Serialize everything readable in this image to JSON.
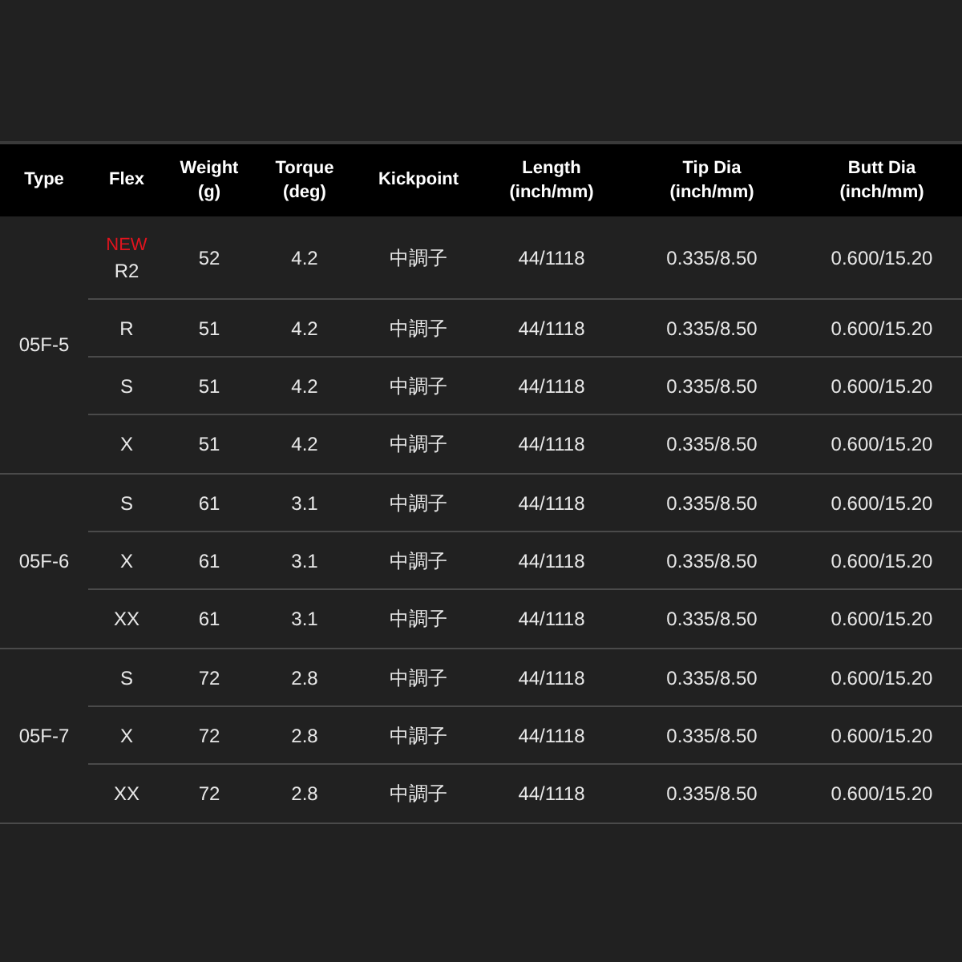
{
  "table": {
    "columns": [
      {
        "label": "Type"
      },
      {
        "label": "Flex"
      },
      {
        "label": "Weight",
        "unit": "(g)"
      },
      {
        "label": "Torque",
        "unit": "(deg)"
      },
      {
        "label": "Kickpoint"
      },
      {
        "label": "Length",
        "unit": "(inch/mm)"
      },
      {
        "label": "Tip Dia",
        "unit": "(inch/mm)"
      },
      {
        "label": "Butt Dia",
        "unit": "(inch/mm)"
      }
    ],
    "groups": [
      {
        "type": "05F-5",
        "rows": [
          {
            "badge": "NEW",
            "flex": "R2",
            "weight": "52",
            "torque": "4.2",
            "kickpoint": "中調子",
            "length": "44/1118",
            "tip_dia": "0.335/8.50",
            "butt_dia": "0.600/15.20"
          },
          {
            "flex": "R",
            "weight": "51",
            "torque": "4.2",
            "kickpoint": "中調子",
            "length": "44/1118",
            "tip_dia": "0.335/8.50",
            "butt_dia": "0.600/15.20"
          },
          {
            "flex": "S",
            "weight": "51",
            "torque": "4.2",
            "kickpoint": "中調子",
            "length": "44/1118",
            "tip_dia": "0.335/8.50",
            "butt_dia": "0.600/15.20"
          },
          {
            "flex": "X",
            "weight": "51",
            "torque": "4.2",
            "kickpoint": "中調子",
            "length": "44/1118",
            "tip_dia": "0.335/8.50",
            "butt_dia": "0.600/15.20"
          }
        ]
      },
      {
        "type": "05F-6",
        "rows": [
          {
            "flex": "S",
            "weight": "61",
            "torque": "3.1",
            "kickpoint": "中調子",
            "length": "44/1118",
            "tip_dia": "0.335/8.50",
            "butt_dia": "0.600/15.20"
          },
          {
            "flex": "X",
            "weight": "61",
            "torque": "3.1",
            "kickpoint": "中調子",
            "length": "44/1118",
            "tip_dia": "0.335/8.50",
            "butt_dia": "0.600/15.20"
          },
          {
            "flex": "XX",
            "weight": "61",
            "torque": "3.1",
            "kickpoint": "中調子",
            "length": "44/1118",
            "tip_dia": "0.335/8.50",
            "butt_dia": "0.600/15.20"
          }
        ]
      },
      {
        "type": "05F-7",
        "rows": [
          {
            "flex": "S",
            "weight": "72",
            "torque": "2.8",
            "kickpoint": "中調子",
            "length": "44/1118",
            "tip_dia": "0.335/8.50",
            "butt_dia": "0.600/15.20"
          },
          {
            "flex": "X",
            "weight": "72",
            "torque": "2.8",
            "kickpoint": "中調子",
            "length": "44/1118",
            "tip_dia": "0.335/8.50",
            "butt_dia": "0.600/15.20"
          },
          {
            "flex": "XX",
            "weight": "72",
            "torque": "2.8",
            "kickpoint": "中調子",
            "length": "44/1118",
            "tip_dia": "0.335/8.50",
            "butt_dia": "0.600/15.20"
          }
        ]
      }
    ]
  }
}
